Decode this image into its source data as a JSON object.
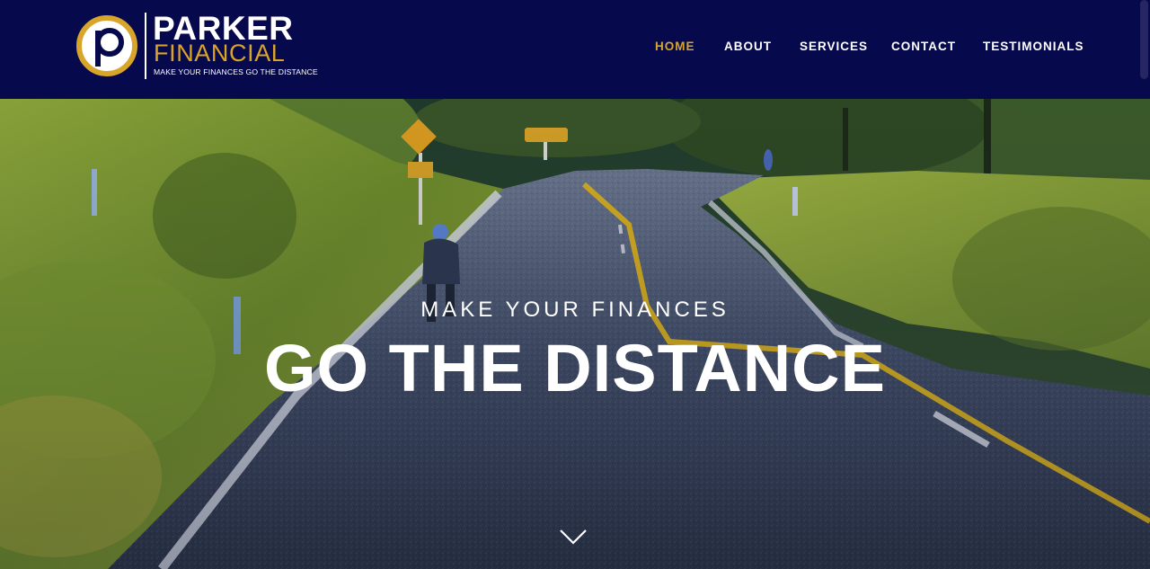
{
  "brand": {
    "name": "PARKER",
    "sub": "FINANCIAL",
    "tagline": "MAKE YOUR FINANCES GO THE DISTANCE",
    "monogram": "p",
    "colors": {
      "navy": "#07094d",
      "gold": "#d8a52a",
      "white": "#ffffff"
    }
  },
  "nav": {
    "items": [
      {
        "label": "HOME",
        "active": true
      },
      {
        "label": "ABOUT",
        "active": false
      },
      {
        "label": "SERVICES",
        "active": false
      },
      {
        "label": "CONTACT",
        "active": false
      },
      {
        "label": "TESTIMONIALS",
        "active": false
      }
    ]
  },
  "hero": {
    "kicker": "MAKE YOUR FINANCES",
    "title": "GO THE DISTANCE",
    "scroll_icon": "chevron-down-icon"
  }
}
